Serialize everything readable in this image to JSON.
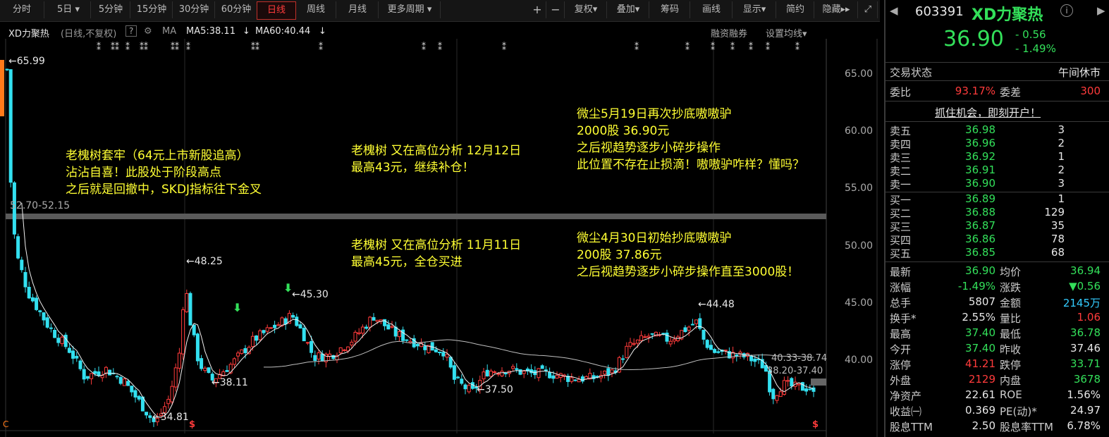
{
  "toolbar": {
    "tabs": [
      "分时",
      "5日",
      "5分钟",
      "15分钟",
      "30分钟",
      "60分钟",
      "日线",
      "周线",
      "月线",
      "更多周期"
    ],
    "active": "日线",
    "right_items": [
      "+",
      "−",
      "复权",
      "叠加",
      "筹码",
      "画线",
      "显示",
      "简约",
      "隐藏"
    ]
  },
  "infobar": {
    "stock_name": "XD力聚热",
    "mode": "(日线,不复权)",
    "help": "?",
    "ma_label": "MA",
    "ma5": "MA5:38.11",
    "ma60": "MA60:40.44",
    "margin": "融资融券",
    "settings": "设置均线"
  },
  "chart_data": {
    "type": "candlestick",
    "y_axis_ticks": [
      "65.00",
      "60.00",
      "55.00",
      "50.00",
      "45.00",
      "40.00"
    ],
    "ylim": [
      35.4,
      66.5
    ],
    "annotations_price": [
      "65.99",
      "52.70-52.15",
      "48.25",
      "45.30",
      "44.48",
      "38.11",
      "37.50",
      "34.81",
      "40.33-38.74",
      "38.20-37.40"
    ]
  },
  "notes": {
    "n1": [
      "老槐树套牢（64元上市新股追高）",
      "沾沾自喜！此股处于阶段高点",
      "之后就是回撤中，SKDJ指标往下金叉"
    ],
    "n2": [
      "老槐树 又在高位分析 12月12日",
      "最高43元，继续补仓！"
    ],
    "n3": [
      "微尘5月19日再次抄底嗷嗷驴",
      "2000股  36.90元",
      "之后视趋势逐步小碎步操作",
      "此位置不存在止损滴！嗷嗷驴咋样？懂吗？"
    ],
    "n4": [
      "老槐树 又在高位分析 11月11日",
      "最高45元，全仓买进"
    ],
    "n5": [
      "微尘4月30日初始抄底嗷嗷驴",
      "200股  37.86元",
      "之后视趋势逐步小碎步操作直至3000股！"
    ]
  },
  "panel": {
    "code": "603391",
    "name": "XD力聚热",
    "price": "36.90",
    "change": "- 0.56",
    "change_pct": "- 1.49%",
    "status_label": "交易状态",
    "status_value": "午间休市",
    "weibi_label": "委比",
    "weibi_value": "93.17%",
    "weicha_label": "委差",
    "weicha_value": "300",
    "promo": "抓住机会，即刻开户！",
    "sell": [
      {
        "label": "卖五",
        "price": "36.98",
        "vol": "3"
      },
      {
        "label": "卖四",
        "price": "36.96",
        "vol": "2"
      },
      {
        "label": "卖三",
        "price": "36.92",
        "vol": "1"
      },
      {
        "label": "卖二",
        "price": "36.91",
        "vol": "2"
      },
      {
        "label": "卖一",
        "price": "36.90",
        "vol": "3"
      }
    ],
    "buy": [
      {
        "label": "买一",
        "price": "36.89",
        "vol": "1"
      },
      {
        "label": "买二",
        "price": "36.88",
        "vol": "129"
      },
      {
        "label": "买三",
        "price": "36.87",
        "vol": "35"
      },
      {
        "label": "买四",
        "price": "36.86",
        "vol": "78"
      },
      {
        "label": "买五",
        "price": "36.85",
        "vol": "68"
      }
    ],
    "stats": [
      {
        "l1": "最新",
        "v1": "36.90",
        "c1": "green",
        "l2": "均价",
        "v2": "36.94",
        "c2": "green"
      },
      {
        "l1": "涨幅",
        "v1": "-1.49%",
        "c1": "green",
        "l2": "涨跌",
        "v2": "▼0.56",
        "c2": "green"
      },
      {
        "l1": "总手",
        "v1": "5807",
        "c1": "white",
        "l2": "金额",
        "v2": "2145万",
        "c2": "cyan"
      },
      {
        "l1": "换手*",
        "v1": "2.55%",
        "c1": "white",
        "l2": "量比",
        "v2": "1.06",
        "c2": "red"
      },
      {
        "l1": "最高",
        "v1": "37.40",
        "c1": "green",
        "l2": "最低",
        "v2": "36.78",
        "c2": "green"
      },
      {
        "l1": "今开",
        "v1": "37.40",
        "c1": "green",
        "l2": "昨收",
        "v2": "37.46",
        "c2": "white"
      },
      {
        "l1": "涨停",
        "v1": "41.21",
        "c1": "red",
        "l2": "跌停",
        "v2": "33.71",
        "c2": "green"
      },
      {
        "l1": "外盘",
        "v1": "2129",
        "c1": "red",
        "l2": "内盘",
        "v2": "3678",
        "c2": "green"
      },
      {
        "l1": "净资产",
        "v1": "22.61",
        "c1": "white",
        "l2": "ROE",
        "v2": "1.56%",
        "c2": "white"
      },
      {
        "l1": "收益㈠",
        "v1": "0.369",
        "c1": "white",
        "l2": "PE(动)*",
        "v2": "24.97",
        "c2": "white"
      },
      {
        "l1": "股息TTM",
        "v1": "2.50",
        "c1": "white",
        "l2": "股息率TTM",
        "v2": "6.78%",
        "c2": "white"
      }
    ]
  }
}
